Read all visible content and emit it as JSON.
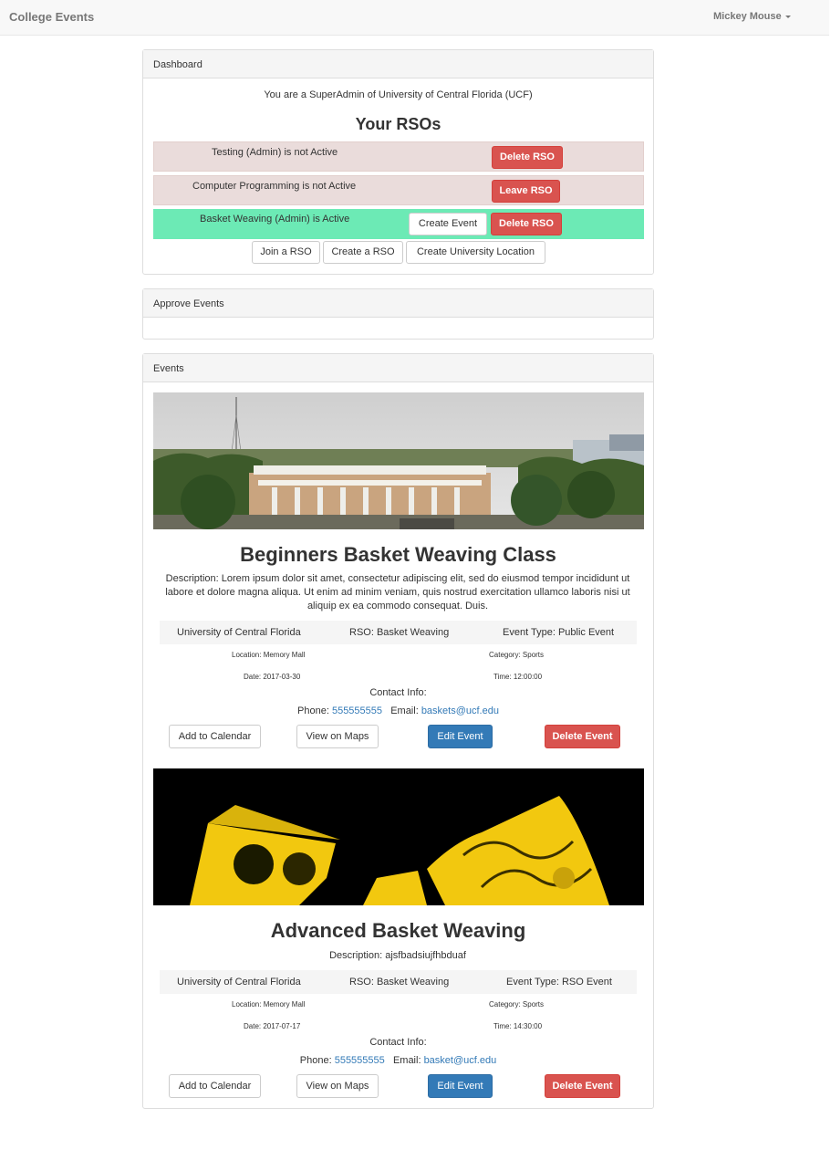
{
  "navbar": {
    "brand": "College Events",
    "user_name": "Mickey Mouse"
  },
  "dashboard": {
    "heading": "Dashboard",
    "role_text": "You are a SuperAdmin of University of Central Florida (UCF)",
    "rsos_title": "Your RSOs",
    "rsos": [
      {
        "label": "Testing (Admin) is not Active",
        "action": "Delete RSO",
        "status": "inactive"
      },
      {
        "label": "Computer Programming is not Active",
        "action": "Leave RSO",
        "status": "inactive"
      },
      {
        "label": "Basket Weaving (Admin) is Active",
        "extra_action": "Create Event",
        "action": "Delete RSO",
        "status": "active"
      }
    ],
    "join_rso": "Join a RSO",
    "create_rso": "Create a RSO",
    "create_location": "Create University Location"
  },
  "approve_events": {
    "heading": "Approve Events"
  },
  "events": {
    "heading": "Events",
    "items": [
      {
        "title": "Beginners Basket Weaving Class",
        "description": "Description: Lorem ipsum dolor sit amet, consectetur adipiscing elit, sed do eiusmod tempor incididunt ut labore et dolore magna aliqua. Ut enim ad minim veniam, quis nostrud exercitation ullamco laboris nisi ut aliquip ex ea commodo consequat. Duis.",
        "university": "University of Central Florida",
        "rso": "RSO: Basket Weaving",
        "event_type": "Event Type: Public Event",
        "location": "Location: Memory Mall",
        "category": "Category: Sports",
        "date": "Date: 2017-03-30",
        "time": "Time: 12:00:00",
        "contact_label": "Contact Info:",
        "phone_label": "Phone:",
        "phone": "555555555",
        "email_label": "Email:",
        "email": "baskets@ucf.edu"
      },
      {
        "title": "Advanced Basket Weaving",
        "description": "Description: ajsfbadsiujfhbduaf",
        "university": "University of Central Florida",
        "rso": "RSO: Basket Weaving",
        "event_type": "Event Type: RSO Event",
        "location": "Location: Memory Mall",
        "category": "Category: Sports",
        "date": "Date: 2017-07-17",
        "time": "Time: 14:30:00",
        "contact_label": "Contact Info:",
        "phone_label": "Phone:",
        "phone": "555555555",
        "email_label": "Email:",
        "email": "basket@ucf.edu"
      }
    ],
    "buttons": {
      "add_calendar": "Add to Calendar",
      "view_maps": "View on Maps",
      "edit": "Edit Event",
      "delete": "Delete Event"
    }
  },
  "colors": {
    "danger": "#d9534f",
    "primary": "#337ab7",
    "active_row": "#6ceab5",
    "inactive_row": "#eadcdb",
    "image_gold": "#f2c80f"
  }
}
